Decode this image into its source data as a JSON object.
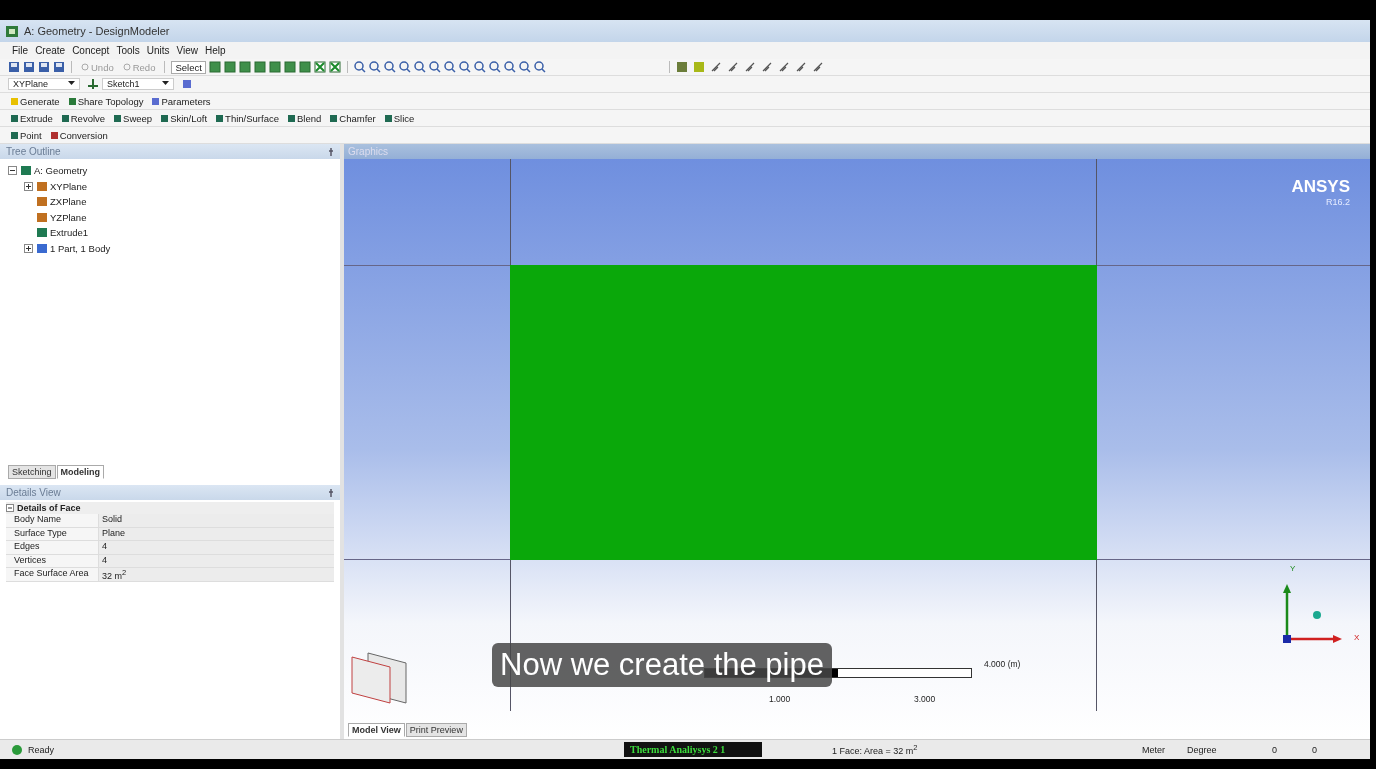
{
  "window": {
    "title": "A: Geometry - DesignModeler"
  },
  "menu": [
    "File",
    "Create",
    "Concept",
    "Tools",
    "Units",
    "View",
    "Help"
  ],
  "toolbar": {
    "undo": "Undo",
    "redo": "Redo",
    "select": "Select"
  },
  "plane_select": {
    "value": "XYPlane"
  },
  "sketch_select": {
    "value": "Sketch1"
  },
  "actions_1": [
    "Generate",
    "Share Topology",
    "Parameters"
  ],
  "actions_2": [
    "Extrude",
    "Revolve",
    "Sweep",
    "Skin/Loft",
    "Thin/Surface",
    "Blend",
    "Chamfer",
    "Slice"
  ],
  "actions_3": [
    "Point",
    "Conversion"
  ],
  "tree_outline": {
    "title": "Tree Outline",
    "items": [
      {
        "label": "A: Geometry",
        "expanded": true,
        "children": [
          {
            "label": "XYPlane",
            "expanded": false
          },
          {
            "label": "ZXPlane"
          },
          {
            "label": "YZPlane"
          },
          {
            "label": "Extrude1"
          },
          {
            "label": "1 Part, 1 Body",
            "expanded": false
          }
        ]
      }
    ]
  },
  "left_tabs": [
    {
      "label": "Sketching",
      "selected": false
    },
    {
      "label": "Modeling",
      "selected": true
    }
  ],
  "details_view": {
    "title": "Details View",
    "section": "Details of Face",
    "rows": [
      {
        "name": "Body Name",
        "value": "Solid"
      },
      {
        "name": "Surface Type",
        "value": "Plane"
      },
      {
        "name": "Edges",
        "value": "4"
      },
      {
        "name": "Vertices",
        "value": "4"
      },
      {
        "name": "Face Surface Area",
        "value": "32 m$^{2}$"
      }
    ]
  },
  "graphics": {
    "title": "Graphics",
    "logo": "ANSYS",
    "version": "R16.2",
    "axis_y": "Y",
    "axis_x": "X",
    "scale": {
      "end_label": "4.000 (m)",
      "ticks": [
        "1.000",
        "3.000"
      ]
    },
    "caption": "Now we create the pipe"
  },
  "view_tabs": [
    {
      "label": "Model View",
      "selected": true
    },
    {
      "label": "Print Preview",
      "selected": false
    }
  ],
  "status_bar": {
    "state": "Ready",
    "analysis": "Thermal Analiysys 2 1",
    "selection": "1 Face: Area = 32 m$^{2}$",
    "length_unit": "Meter",
    "angle_unit": "Degree",
    "field_1": "0",
    "field_2": "0"
  }
}
